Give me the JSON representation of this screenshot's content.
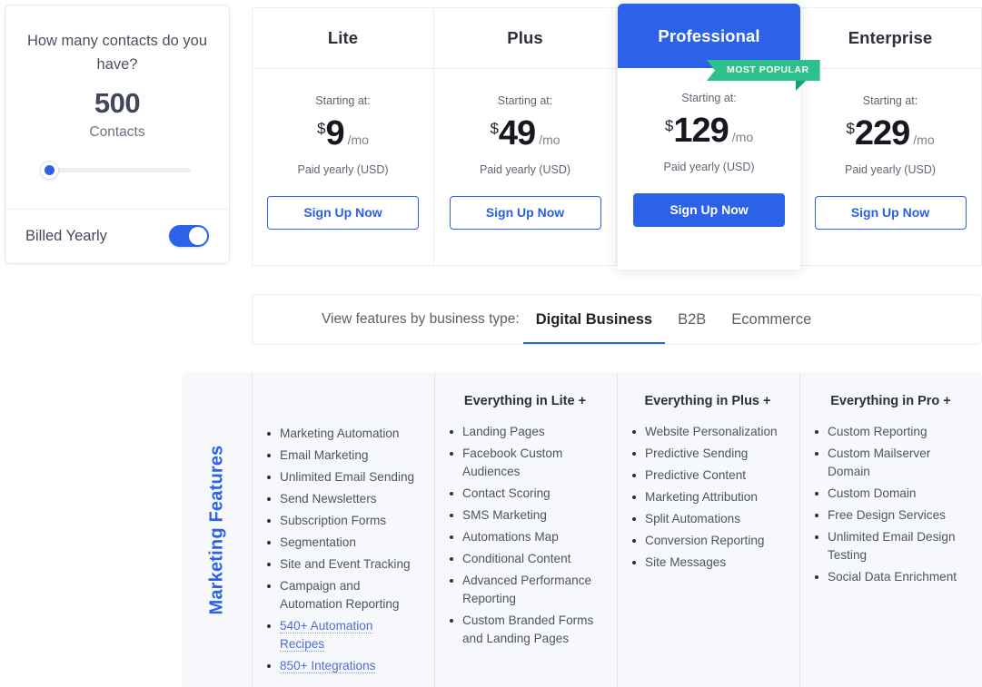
{
  "contacts_panel": {
    "question": "How many contacts do you have?",
    "count": "500",
    "unit": "Contacts",
    "slider_value_label": "500",
    "billing_label": "Billed Yearly",
    "billing_toggle_state": "on",
    "accent_color": "#2c62e8"
  },
  "plans": [
    {
      "name": "Lite",
      "starting_at": "Starting at:",
      "currency": "$",
      "amount": "9",
      "per": "/mo",
      "note": "Paid yearly (USD)",
      "cta": "Sign Up Now",
      "featured": false
    },
    {
      "name": "Plus",
      "starting_at": "Starting at:",
      "currency": "$",
      "amount": "49",
      "per": "/mo",
      "note": "Paid yearly (USD)",
      "cta": "Sign Up Now",
      "featured": false
    },
    {
      "name": "Professional",
      "starting_at": "Starting at:",
      "currency": "$",
      "amount": "129",
      "per": "/mo",
      "note": "Paid yearly (USD)",
      "cta": "Sign Up Now",
      "featured": true,
      "badge": "MOST POPULAR",
      "badge_color": "#2ec08b"
    },
    {
      "name": "Enterprise",
      "starting_at": "Starting at:",
      "currency": "$",
      "amount": "229",
      "per": "/mo",
      "note": "Paid yearly (USD)",
      "cta": "Sign Up Now",
      "featured": false
    }
  ],
  "business_type": {
    "label": "View features by business type:",
    "tabs": [
      {
        "label": "Digital Business",
        "active": true
      },
      {
        "label": "B2B",
        "active": false
      },
      {
        "label": "Ecommerce",
        "active": false
      }
    ]
  },
  "features": {
    "section_label": "Marketing Features",
    "section_label_color": "#2c62e8",
    "columns": [
      {
        "title": "",
        "items": [
          {
            "text": "Marketing Automation",
            "link": false
          },
          {
            "text": "Email Marketing",
            "link": false
          },
          {
            "text": "Unlimited Email Sending",
            "link": false
          },
          {
            "text": "Send Newsletters",
            "link": false
          },
          {
            "text": "Subscription Forms",
            "link": false
          },
          {
            "text": "Segmentation",
            "link": false
          },
          {
            "text": "Site and Event Tracking",
            "link": false
          },
          {
            "text": "Campaign and Automation Reporting",
            "link": false
          },
          {
            "text": "540+ Automation Recipes",
            "link": true
          },
          {
            "text": "850+ Integrations",
            "link": true
          }
        ]
      },
      {
        "title": "Everything in Lite +",
        "items": [
          {
            "text": "Landing Pages",
            "link": false
          },
          {
            "text": "Facebook Custom Audiences",
            "link": false
          },
          {
            "text": "Contact Scoring",
            "link": false
          },
          {
            "text": "SMS Marketing",
            "link": false
          },
          {
            "text": "Automations Map",
            "link": false
          },
          {
            "text": "Conditional Content",
            "link": false
          },
          {
            "text": "Advanced Performance Reporting",
            "link": false
          },
          {
            "text": "Custom Branded Forms and Landing Pages",
            "link": false
          }
        ]
      },
      {
        "title": "Everything in Plus +",
        "items": [
          {
            "text": "Website Personalization",
            "link": false
          },
          {
            "text": "Predictive Sending",
            "link": false
          },
          {
            "text": "Predictive Content",
            "link": false
          },
          {
            "text": "Marketing Attribution",
            "link": false
          },
          {
            "text": "Split Automations",
            "link": false
          },
          {
            "text": "Conversion Reporting",
            "link": false
          },
          {
            "text": "Site Messages",
            "link": false
          }
        ]
      },
      {
        "title": "Everything in Pro +",
        "items": [
          {
            "text": "Custom Reporting",
            "link": false
          },
          {
            "text": "Custom Mailserver Domain",
            "link": false
          },
          {
            "text": "Custom Domain",
            "link": false
          },
          {
            "text": "Free Design Services",
            "link": false
          },
          {
            "text": "Unlimited Email Design Testing",
            "link": false
          },
          {
            "text": "Social Data Enrichment",
            "link": false
          }
        ]
      }
    ]
  }
}
